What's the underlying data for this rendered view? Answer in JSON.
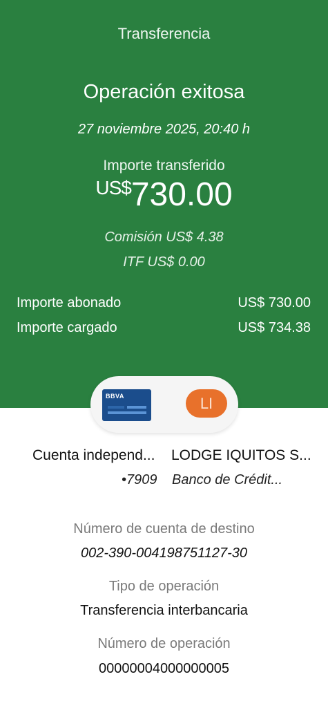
{
  "header": {
    "screen_title": "Transferencia",
    "status": "Operación exitosa",
    "datetime": "27 noviembre 2025,  20:40 h",
    "amount_label": "Importe transferido",
    "amount_currency": "US$",
    "amount_value": "730.00",
    "fee": "Comisión  US$ 4.38",
    "itf": "ITF  US$ 0.00",
    "credited_label": "Importe abonado",
    "credited_value": "US$ 730.00",
    "charged_label": "Importe cargado",
    "charged_value": "US$ 734.38",
    "background_color": "#2a8040"
  },
  "parties": {
    "bank_logo_text": "BBVA",
    "recipient_initials": "LI",
    "recipient_avatar_color": "#e8712b",
    "origin_account_name": "Cuenta independ...",
    "origin_account_number": "•7909",
    "destination_name": "LODGE IQUITOS S...",
    "destination_bank": "Banco de Crédit..."
  },
  "details": {
    "destination_account_label": "Número de cuenta de destino",
    "destination_account_value": "002-390-004198751127-30",
    "operation_type_label": "Tipo de operación",
    "operation_type_value": "Transferencia interbancaria",
    "operation_number_label": "Número de operación",
    "operation_number_value": "00000004000000005"
  }
}
